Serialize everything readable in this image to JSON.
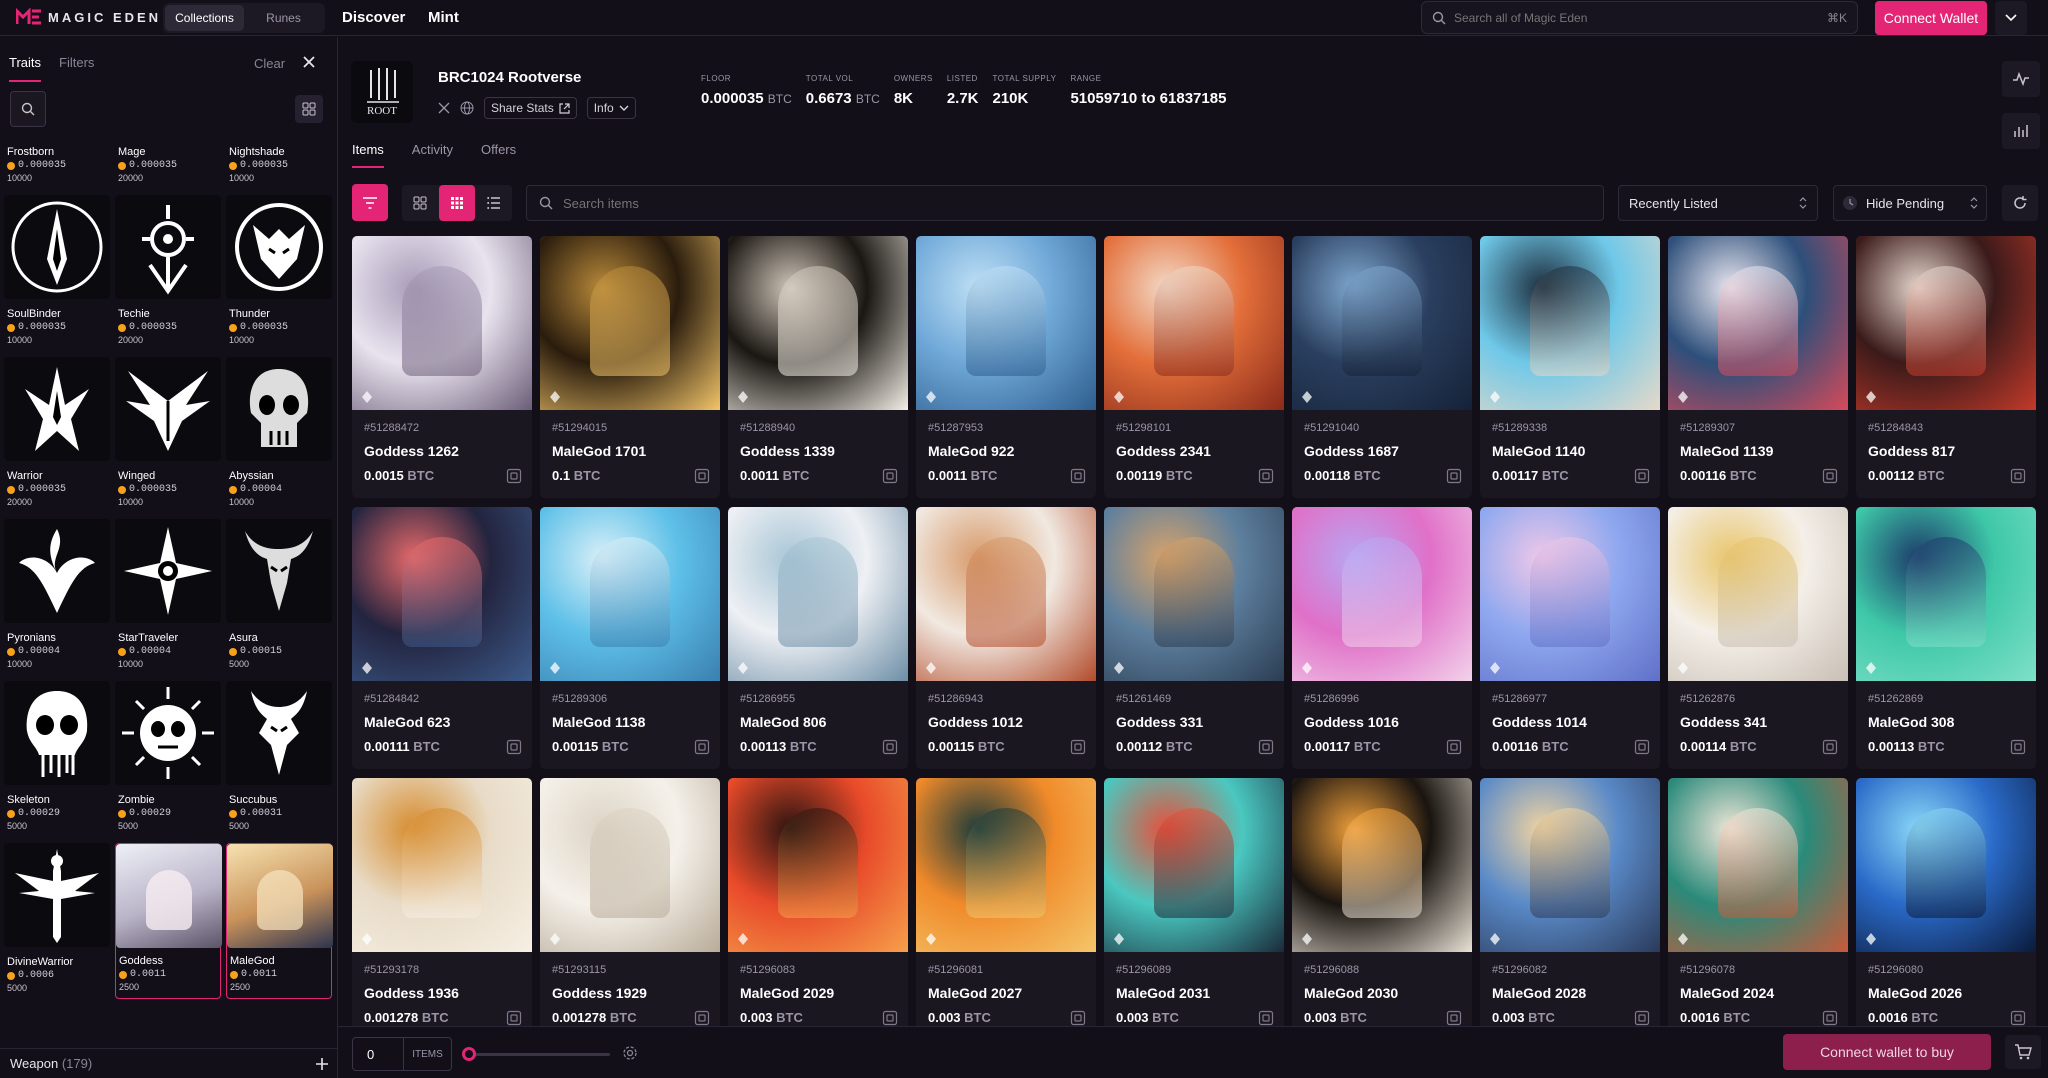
{
  "app": {
    "brand": "MAGIC EDEN",
    "segments": [
      {
        "label": "Collections",
        "active": true
      },
      {
        "label": "Runes",
        "active": false
      }
    ],
    "nav": [
      "Discover",
      "Mint"
    ],
    "search_placeholder": "Search all of Magic Eden",
    "search_shortcut": "⌘K",
    "connect_wallet": "Connect Wallet",
    "accent": "#e42575"
  },
  "sidebar": {
    "tabs": [
      "Traits",
      "Filters"
    ],
    "clear": "Clear",
    "traits": [
      {
        "name": "Frostborn",
        "price": "0.000035",
        "count": "10000",
        "icon": "none"
      },
      {
        "name": "Mage",
        "price": "0.000035",
        "count": "20000",
        "icon": "none"
      },
      {
        "name": "Nightshade",
        "price": "0.000035",
        "count": "10000",
        "icon": "none"
      },
      {
        "name": "SoulBinder",
        "price": "0.000035",
        "count": "10000",
        "icon": "blade-circle"
      },
      {
        "name": "Techie",
        "price": "0.000035",
        "count": "20000",
        "icon": "eye-sigil"
      },
      {
        "name": "Thunder",
        "price": "0.000035",
        "count": "10000",
        "icon": "demon-circle"
      },
      {
        "name": "Warrior",
        "price": "0.000035",
        "count": "20000",
        "icon": "tribal-blade"
      },
      {
        "name": "Winged",
        "price": "0.000035",
        "count": "10000",
        "icon": "wings"
      },
      {
        "name": "Abyssian",
        "price": "0.00004",
        "count": "10000",
        "icon": "skull-mask"
      },
      {
        "name": "Pyronians",
        "price": "0.00004",
        "count": "10000",
        "icon": "flame-sigil"
      },
      {
        "name": "StarTraveler",
        "price": "0.00004",
        "count": "10000",
        "icon": "compass-star"
      },
      {
        "name": "Asura",
        "price": "0.00015",
        "count": "5000",
        "icon": "horned-demon"
      },
      {
        "name": "Skeleton",
        "price": "0.00029",
        "count": "5000",
        "icon": "skull"
      },
      {
        "name": "Zombie",
        "price": "0.00029",
        "count": "5000",
        "icon": "sun-skull"
      },
      {
        "name": "Succubus",
        "price": "0.00031",
        "count": "5000",
        "icon": "horned-mask"
      },
      {
        "name": "DivineWarrior",
        "price": "0.0006",
        "count": "5000",
        "icon": "winged-sword"
      },
      {
        "name": "Goddess",
        "price": "0.0011",
        "count": "2500",
        "icon": "goddess-portrait"
      },
      {
        "name": "MaleGod",
        "price": "0.0011",
        "count": "2500",
        "icon": "malegod-portrait"
      }
    ],
    "weapon_label": "Weapon",
    "weapon_count": "(179)"
  },
  "collection": {
    "name": "BRC1024 Rootverse",
    "logo_text": "ROOT",
    "share_stats": "Share Stats",
    "info": "Info",
    "stats": [
      {
        "label": "FLOOR",
        "value": "0.000035",
        "unit": "BTC"
      },
      {
        "label": "TOTAL VOL",
        "value": "0.6673",
        "unit": "BTC"
      },
      {
        "label": "OWNERS",
        "value": "8K",
        "unit": ""
      },
      {
        "label": "LISTED",
        "value": "2.7K",
        "unit": ""
      },
      {
        "label": "TOTAL SUPPLY",
        "value": "210K",
        "unit": ""
      },
      {
        "label": "RANGE",
        "value": "51059710 to 61837185",
        "unit": ""
      }
    ]
  },
  "tabs": [
    {
      "label": "Items",
      "active": true
    },
    {
      "label": "Activity",
      "active": false
    },
    {
      "label": "Offers",
      "active": false
    }
  ],
  "toolbar": {
    "search_placeholder": "Search items",
    "sort": "Recently Listed",
    "hide_pending": "Hide Pending"
  },
  "items": [
    {
      "id": "#51288472",
      "name": "Goddess 1262",
      "price": "0.0015",
      "unit": "BTC",
      "c1": "#e9e3ee",
      "c2": "#a89cb8",
      "c3": "#6b5d78"
    },
    {
      "id": "#51294015",
      "name": "MaleGod 1701",
      "price": "0.1",
      "unit": "BTC",
      "c1": "#2a1c0d",
      "c2": "#b98a3a",
      "c3": "#f2c56a"
    },
    {
      "id": "#51288940",
      "name": "Goddess 1339",
      "price": "0.0011",
      "unit": "BTC",
      "c1": "#1a1612",
      "c2": "#cfc6b9",
      "c3": "#f4efe6"
    },
    {
      "id": "#51287953",
      "name": "MaleGod 922",
      "price": "0.0011",
      "unit": "BTC",
      "c1": "#6fa8d8",
      "c2": "#bfe0f5",
      "c3": "#2d5d8d"
    },
    {
      "id": "#51298101",
      "name": "Goddess 2341",
      "price": "0.00119",
      "unit": "BTC",
      "c1": "#e36f3a",
      "c2": "#f3d9c6",
      "c3": "#8a2a1a"
    },
    {
      "id": "#51291040",
      "name": "Goddess 1687",
      "price": "0.00118",
      "unit": "BTC",
      "c1": "#2a3f5f",
      "c2": "#7fa7cf",
      "c3": "#152238"
    },
    {
      "id": "#51289338",
      "name": "MaleGod 1140",
      "price": "0.00117",
      "unit": "BTC",
      "c1": "#6fc8e8",
      "c2": "#1e2e3e",
      "c3": "#e7d9c9"
    },
    {
      "id": "#51289307",
      "name": "MaleGod 1139",
      "price": "0.00116",
      "unit": "BTC",
      "c1": "#2d4f7a",
      "c2": "#e8e6ef",
      "c3": "#d64a5a"
    },
    {
      "id": "#51284843",
      "name": "Goddess 817",
      "price": "0.00112",
      "unit": "BTC",
      "c1": "#3b1a1a",
      "c2": "#e5d6cd",
      "c3": "#c43a2a"
    },
    {
      "id": "#51284842",
      "name": "MaleGod 623",
      "price": "0.00111",
      "unit": "BTC",
      "c1": "#23243f",
      "c2": "#e86a6a",
      "c3": "#3c5a8a"
    },
    {
      "id": "#51289306",
      "name": "MaleGod 1138",
      "price": "0.00115",
      "unit": "BTC",
      "c1": "#5ec0e8",
      "c2": "#d9f0f8",
      "c3": "#3a7fb0"
    },
    {
      "id": "#51286955",
      "name": "MaleGod 806",
      "price": "0.00113",
      "unit": "BTC",
      "c1": "#eef0f4",
      "c2": "#a8c6d6",
      "c3": "#6c8ea6"
    },
    {
      "id": "#51286943",
      "name": "Goddess 1012",
      "price": "0.00115",
      "unit": "BTC",
      "c1": "#f1e9e1",
      "c2": "#d79a6a",
      "c3": "#b24a2a"
    },
    {
      "id": "#51261469",
      "name": "Goddess 331",
      "price": "0.00112",
      "unit": "BTC",
      "c1": "#5d7f9e",
      "c2": "#d8a36a",
      "c3": "#2b3d52"
    },
    {
      "id": "#51286996",
      "name": "Goddess 1016",
      "price": "0.00117",
      "unit": "BTC",
      "c1": "#e070c8",
      "c2": "#b8a6f2",
      "c3": "#f2d2ea"
    },
    {
      "id": "#51286977",
      "name": "Goddess 1014",
      "price": "0.00116",
      "unit": "BTC",
      "c1": "#8fa8ef",
      "c2": "#f0c8e8",
      "c3": "#6070c8"
    },
    {
      "id": "#51262876",
      "name": "Goddess 341",
      "price": "0.00114",
      "unit": "BTC",
      "c1": "#f4efe8",
      "c2": "#e9c56a",
      "c3": "#c8bfb5"
    },
    {
      "id": "#51262869",
      "name": "MaleGod 308",
      "price": "0.00113",
      "unit": "BTC",
      "c1": "#3ec8a8",
      "c2": "#1c3a6a",
      "c3": "#7fe0c8"
    },
    {
      "id": "#51293178",
      "name": "Goddess 1936",
      "price": "0.001278",
      "unit": "BTC",
      "c1": "#e8dcc8",
      "c2": "#d68a2a",
      "c3": "#f6efe4"
    },
    {
      "id": "#51293115",
      "name": "Goddess 1929",
      "price": "0.001278",
      "unit": "BTC",
      "c1": "#f5f1ea",
      "c2": "#dcd3c4",
      "c3": "#b8ab98"
    },
    {
      "id": "#51296083",
      "name": "MaleGod 2029",
      "price": "0.003",
      "unit": "BTC",
      "c1": "#e84a2a",
      "c2": "#2a1410",
      "c3": "#f6a04a"
    },
    {
      "id": "#51296081",
      "name": "MaleGod 2027",
      "price": "0.003",
      "unit": "BTC",
      "c1": "#f08a2a",
      "c2": "#1a3a3a",
      "c3": "#f4c66a"
    },
    {
      "id": "#51296089",
      "name": "MaleGod 2031",
      "price": "0.003",
      "unit": "BTC",
      "c1": "#4ac8c0",
      "c2": "#e8503a",
      "c3": "#1a2a3a"
    },
    {
      "id": "#51296088",
      "name": "MaleGod 2030",
      "price": "0.003",
      "unit": "BTC",
      "c1": "#1a1410",
      "c2": "#f0a03a",
      "c3": "#e8e2d6"
    },
    {
      "id": "#51296082",
      "name": "MaleGod 2028",
      "price": "0.003",
      "unit": "BTC",
      "c1": "#5a8ac8",
      "c2": "#f2d4a0",
      "c3": "#2a3a5a"
    },
    {
      "id": "#51296078",
      "name": "MaleGod 2024",
      "price": "0.0016",
      "unit": "BTC",
      "c1": "#2a8a7a",
      "c2": "#f0e6d8",
      "c3": "#c85a3a"
    },
    {
      "id": "#51296080",
      "name": "MaleGod 2026",
      "price": "0.0016",
      "unit": "BTC",
      "c1": "#2a6ac8",
      "c2": "#8ad8f8",
      "c3": "#0a1a3a"
    }
  ],
  "bottom": {
    "qty": "0",
    "items_label": "ITEMS",
    "buy": "Connect wallet to buy"
  }
}
